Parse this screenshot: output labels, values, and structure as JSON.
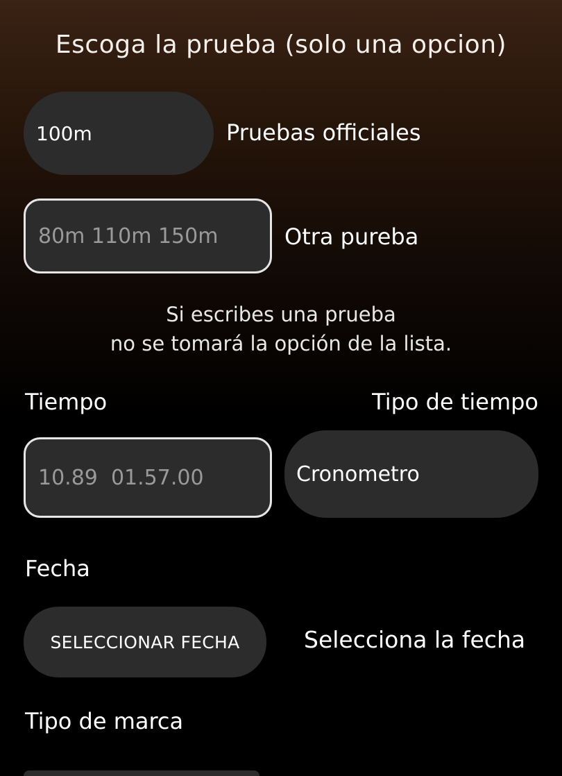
{
  "header": {
    "title": "Escoga la prueba (solo una opcion)"
  },
  "event_select": {
    "value": "100m",
    "label": "Pruebas officiales"
  },
  "other_event": {
    "placeholder": "80m 110m 150m",
    "label": "Otra pureba"
  },
  "hint": {
    "line1": "Si escribes una prueba",
    "line2": "no se tomará la opción de la lista."
  },
  "time": {
    "label": "Tiempo",
    "placeholder": "10.89  01.57.00"
  },
  "time_type": {
    "label": "Tipo de tiempo",
    "value": "Cronometro"
  },
  "date": {
    "label": "Fecha",
    "button_label": "SELECCIONAR FECHA",
    "value_text": "Selecciona la fecha"
  },
  "mark_type": {
    "label": "Tipo de marca"
  },
  "colors": {
    "background_top": "#3a2214",
    "background_bottom": "#000000",
    "control": "#2c2c2c",
    "field_border": "#e6e6e6",
    "placeholder": "#9a9a9a"
  }
}
